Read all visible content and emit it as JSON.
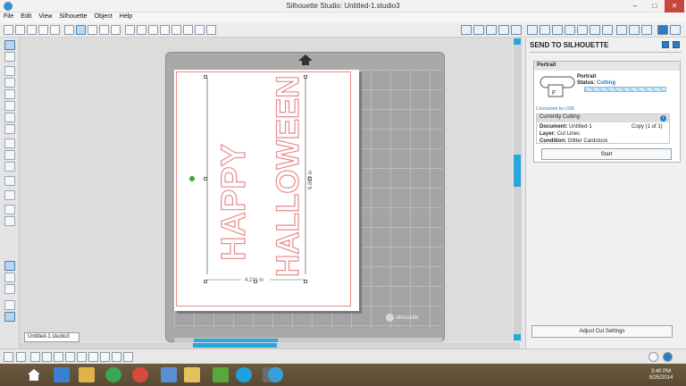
{
  "window": {
    "title": "Silhouette Studio: Untitled-1.studio3",
    "minimize": "–",
    "maximize": "□",
    "close": "✕"
  },
  "menu": [
    "File",
    "Edit",
    "View",
    "Silhouette",
    "Object",
    "Help"
  ],
  "canvas": {
    "text_happy": "HAPPY",
    "text_halloween": "HALLOWEEN",
    "width_dim": "4.211 in",
    "height_dim": "6.889 in",
    "watermark": "silhouette",
    "doc_tab": "Untitled-1.studio3"
  },
  "panel": {
    "title": "SEND TO SILHOUETTE",
    "device_section": "Portrait",
    "device_name": "Portrait",
    "status_label": "Status:",
    "status_value": "Cutting",
    "connected": "Connected by USB",
    "currently": "Currently Cutting",
    "document_label": "Document:",
    "document_value": "Untitled-1",
    "copy": "Copy (1 of 1)",
    "layer_label": "Layer:",
    "layer_value": "Cut Lines",
    "condition_label": "Condition:",
    "condition_value": "Glitter Cardstock",
    "start": "Start",
    "adjust": "Adjust Cut Settings"
  },
  "taskbar": {
    "time": "3:40 PM",
    "date": "9/25/2014"
  },
  "colors": {
    "accent": "#2aa6dd",
    "cutline": "#e88a8a",
    "panel_blue": "#2d7cc0"
  }
}
